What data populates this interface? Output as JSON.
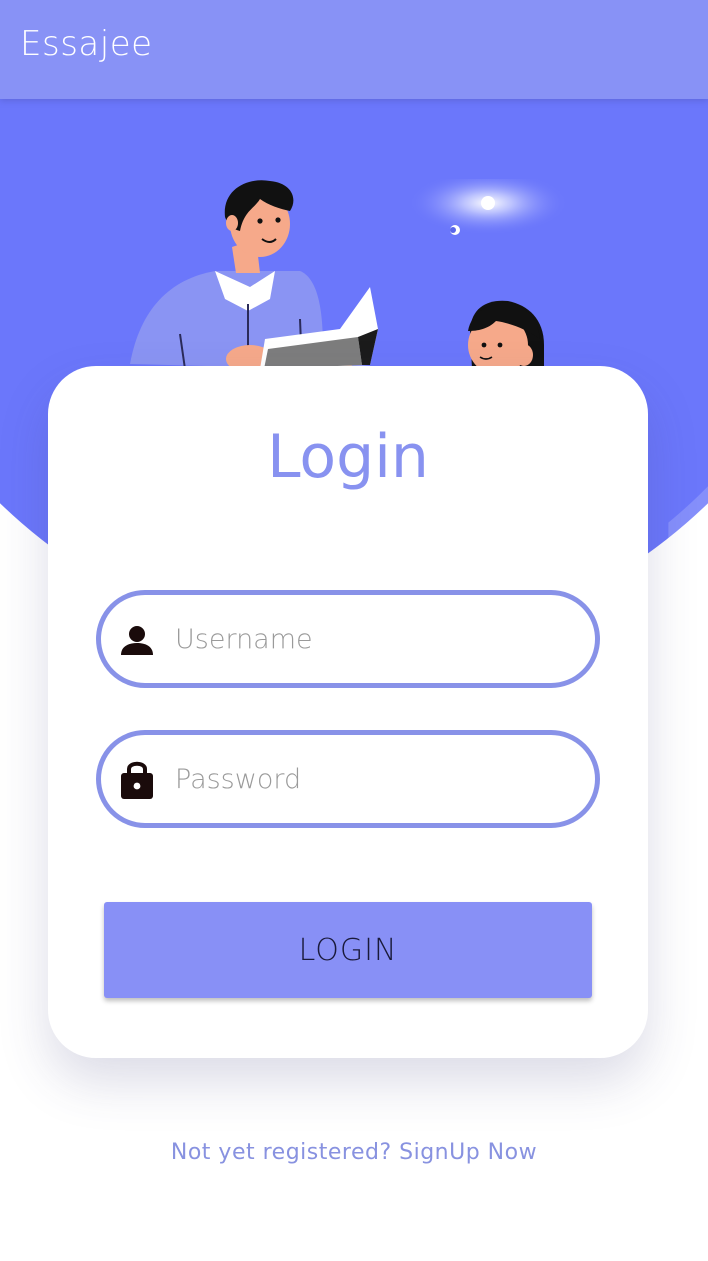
{
  "app_bar": {
    "title": "Essajee"
  },
  "login_card": {
    "title": "Login",
    "username": {
      "placeholder": "Username",
      "value": "",
      "icon": "person-icon"
    },
    "password": {
      "placeholder": "Password",
      "value": "",
      "icon": "lock-icon"
    },
    "submit_label": "LOGIN"
  },
  "footer": {
    "signup_text": "Not yet registered? SignUp Now"
  },
  "colors": {
    "app_bar": "#8892f6",
    "hero": "#6b77fb",
    "accent": "#8892e8",
    "button": "#8890f6"
  }
}
